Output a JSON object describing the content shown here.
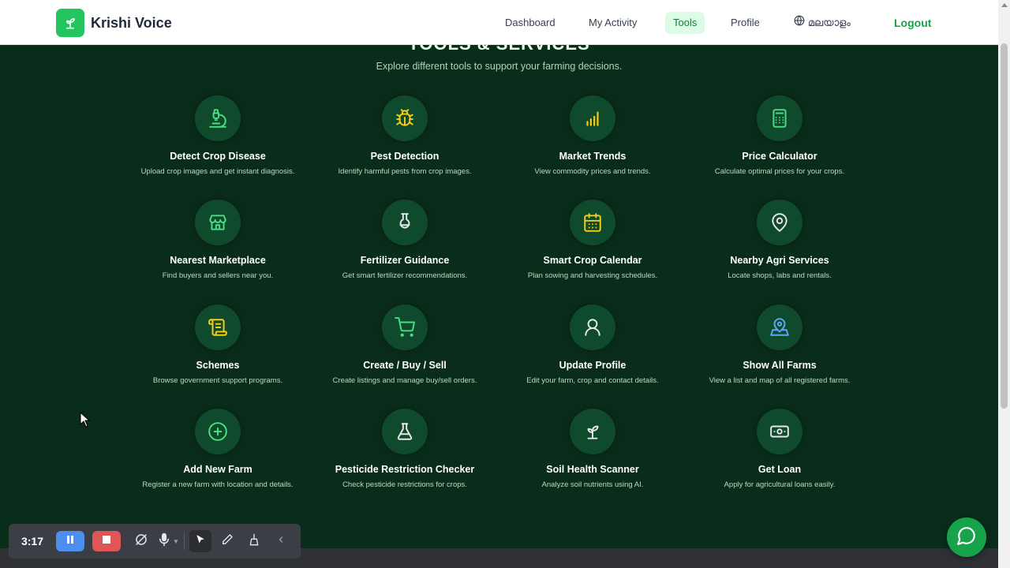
{
  "brand": {
    "name": "Krishi Voice",
    "icon": "sprout-icon"
  },
  "nav": {
    "dashboard": "Dashboard",
    "my_activity": "My Activity",
    "tools": "Tools",
    "profile": "Profile",
    "language": "മലയാളം",
    "logout": "Logout"
  },
  "section": {
    "title": "TOOLS & SERVICES",
    "subtitle": "Explore different tools to support your farming decisions."
  },
  "tools": [
    {
      "name": "Detect Crop Disease",
      "desc": "Upload crop images and get instant diagnosis.",
      "icon": "microscope-icon"
    },
    {
      "name": "Pest Detection",
      "desc": "Identify harmful pests from crop images.",
      "icon": "bug-icon"
    },
    {
      "name": "Market Trends",
      "desc": "View commodity prices and trends.",
      "icon": "bar-chart-icon"
    },
    {
      "name": "Price Calculator",
      "desc": "Calculate optimal prices for your crops.",
      "icon": "calculator-icon"
    },
    {
      "name": "Nearest Marketplace",
      "desc": "Find buyers and sellers near you.",
      "icon": "store-icon"
    },
    {
      "name": "Fertilizer Guidance",
      "desc": "Get smart fertilizer recommendations.",
      "icon": "flask-icon"
    },
    {
      "name": "Smart Crop Calendar",
      "desc": "Plan sowing and harvesting schedules.",
      "icon": "calendar-icon"
    },
    {
      "name": "Nearby Agri Services",
      "desc": "Locate shops, labs and rentals.",
      "icon": "map-pin-icon"
    },
    {
      "name": "Schemes",
      "desc": "Browse government support programs.",
      "icon": "scroll-icon"
    },
    {
      "name": "Create / Buy / Sell",
      "desc": "Create listings and manage buy/sell orders.",
      "icon": "cart-icon"
    },
    {
      "name": "Update Profile",
      "desc": "Edit your farm, crop and contact details.",
      "icon": "user-icon"
    },
    {
      "name": "Show All Farms",
      "desc": "View a list and map of all registered farms.",
      "icon": "map-marker-icon"
    },
    {
      "name": "Add New Farm",
      "desc": "Register a new farm with location and details.",
      "icon": "plus-circle-icon"
    },
    {
      "name": "Pesticide Restriction Checker",
      "desc": "Check pesticide restrictions for crops.",
      "icon": "beaker-icon"
    },
    {
      "name": "Soil Health Scanner",
      "desc": "Analyze soil nutrients using AI.",
      "icon": "sprout-icon"
    },
    {
      "name": "Get Loan",
      "desc": "Apply for agricultural loans easily.",
      "icon": "banknote-icon"
    }
  ],
  "recorder": {
    "time": "3:17"
  },
  "colors": {
    "background": "#0a2d1b",
    "accent": "#22c55e",
    "icon_green": "#4ade80",
    "icon_yellow": "#facc15",
    "icon_blue": "#60a5fa"
  }
}
